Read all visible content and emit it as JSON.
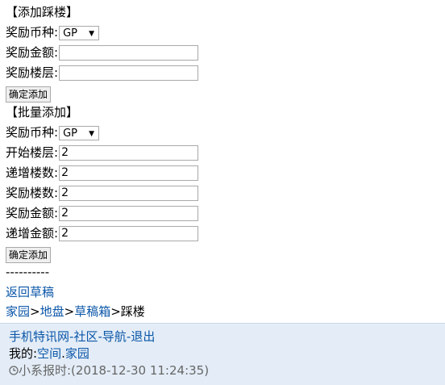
{
  "add_single": {
    "heading": "【添加踩楼】",
    "currency_label": "奖励币种:",
    "currency_value": "GP",
    "amount_label": "奖励金额:",
    "amount_value": "",
    "floor_label": "奖励楼层:",
    "floor_value": "",
    "submit_label": "确定添加"
  },
  "add_batch": {
    "heading": "【批量添加】",
    "currency_label": "奖励币种:",
    "currency_value": "GP",
    "start_floor_label": "开始楼层:",
    "start_floor_value": "2",
    "increment_floors_label": "递增楼数:",
    "increment_floors_value": "2",
    "reward_floors_label": "奖励楼数:",
    "reward_floors_value": "2",
    "amount_label": "奖励金额:",
    "amount_value": "2",
    "increment_amount_label": "递增金额:",
    "increment_amount_value": "2",
    "submit_label": "确定添加"
  },
  "divider": "----------",
  "back_link": "返回草稿",
  "breadcrumb": {
    "home": "家园",
    "sep1": ">",
    "area": "地盘",
    "sep2": ">",
    "drafts": "草稿箱",
    "sep3": ">",
    "current": "踩楼"
  },
  "footer": {
    "site": "手机特讯网",
    "dash1": "-",
    "community": "社区",
    "dash2": "-",
    "navigation": "导航",
    "dash3": "-",
    "logout": "退出",
    "mine_label": "我的:",
    "space": "空间",
    "dot": ".",
    "home": "家园",
    "time_text": "小系报时:(2018-12-30 11:24:35)"
  },
  "icons": {
    "dropdown_arrow": "▼",
    "clock": "clock-icon"
  },
  "colors": {
    "link": "#0a56a8",
    "footer_bg": "#e4edf7"
  }
}
